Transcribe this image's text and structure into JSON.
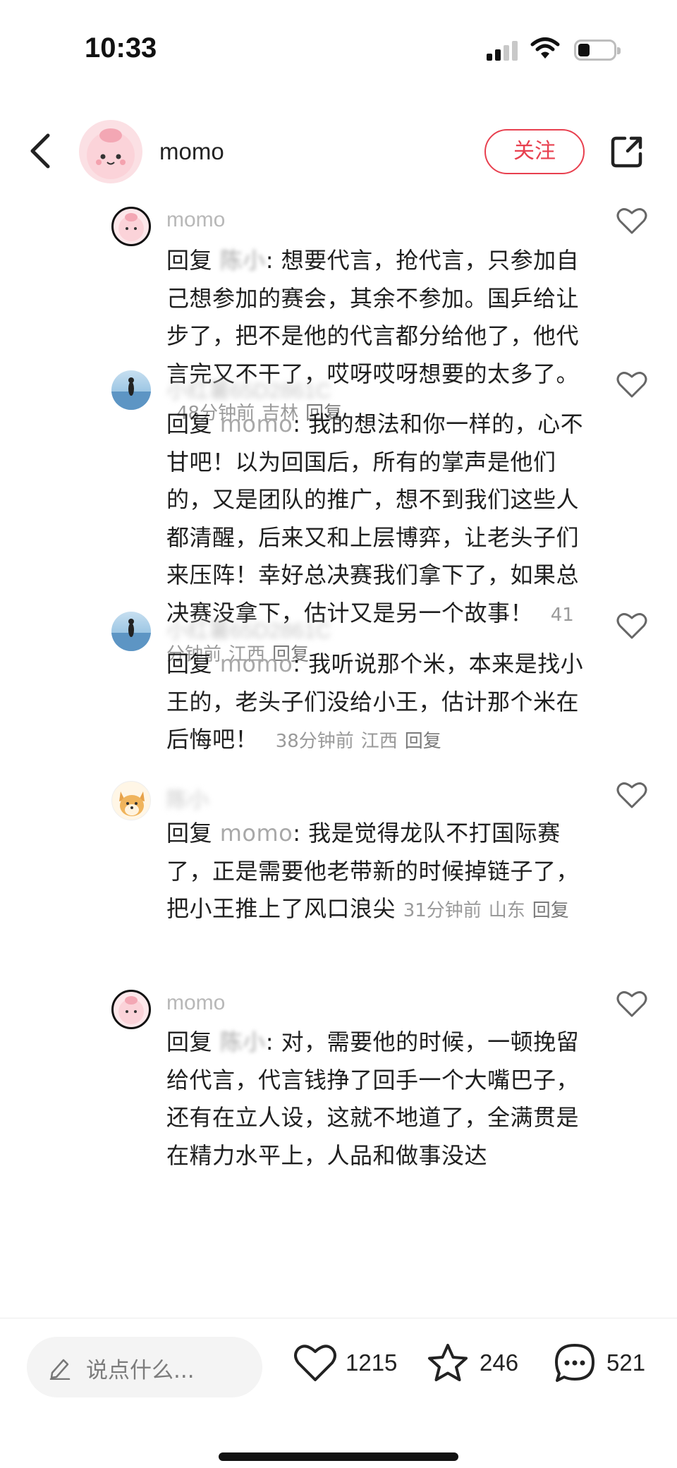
{
  "status_bar": {
    "time": "10:33"
  },
  "header": {
    "name": "momo",
    "follow_label": "关注"
  },
  "comments": [
    {
      "name": "momo",
      "reply_word": "回复",
      "reply_to": "陈小",
      "text": ": 想要代言，抢代言，只参加自己想参加的赛会，其余不参加。国乒给让步了，把不是他的代言都分给他了，他代言完又不干了，哎呀哎呀想要的太多了。",
      "time": "48分钟前",
      "location": "吉林",
      "reply_label": "回复"
    },
    {
      "name": "小红薯65D2861C",
      "reply_word": "回复",
      "reply_to": "momo",
      "text": ": 我的想法和你一样的，心不甘吧！以为回国后，所有的掌声是他们的，又是团队的推广，想不到我们这些人都清醒，后来又和上层博弈，让老头子们来压阵！幸好总决赛我们拿下了，如果总决赛没拿下，估计又是另一个故事！",
      "time": "41分钟前",
      "location": "江西",
      "reply_label": "回复"
    },
    {
      "name": "小红薯65D2861C",
      "reply_word": "回复",
      "reply_to": "momo",
      "text": ": 我听说那个米，本来是找小王的，老头子们没给小王，估计那个米在后悔吧！",
      "time": "38分钟前",
      "location": "江西",
      "reply_label": "回复"
    },
    {
      "name": "陈小",
      "reply_word": "回复",
      "reply_to": "momo",
      "text": ": 我是觉得龙队不打国际赛了，正是需要他老带新的时候掉链子了，把小王推上了风口浪尖",
      "time": "31分钟前",
      "location": "山东",
      "reply_label": "回复"
    },
    {
      "name": "momo",
      "reply_word": "回复",
      "reply_to": "陈小",
      "text": ": 对，需要他的时候，一顿挽留给代言，代言钱挣了回手一个大嘴巴子，还有在立人设，这就不地道了，全满贯是在精力水平上，人品和做事没达",
      "time": "",
      "location": "",
      "reply_label": ""
    }
  ],
  "bottom_bar": {
    "input_placeholder": "说点什么...",
    "likes": "1215",
    "favorites": "246",
    "comments": "521"
  },
  "colors": {
    "accent": "#e8404f",
    "muted": "#9a9a9a"
  }
}
